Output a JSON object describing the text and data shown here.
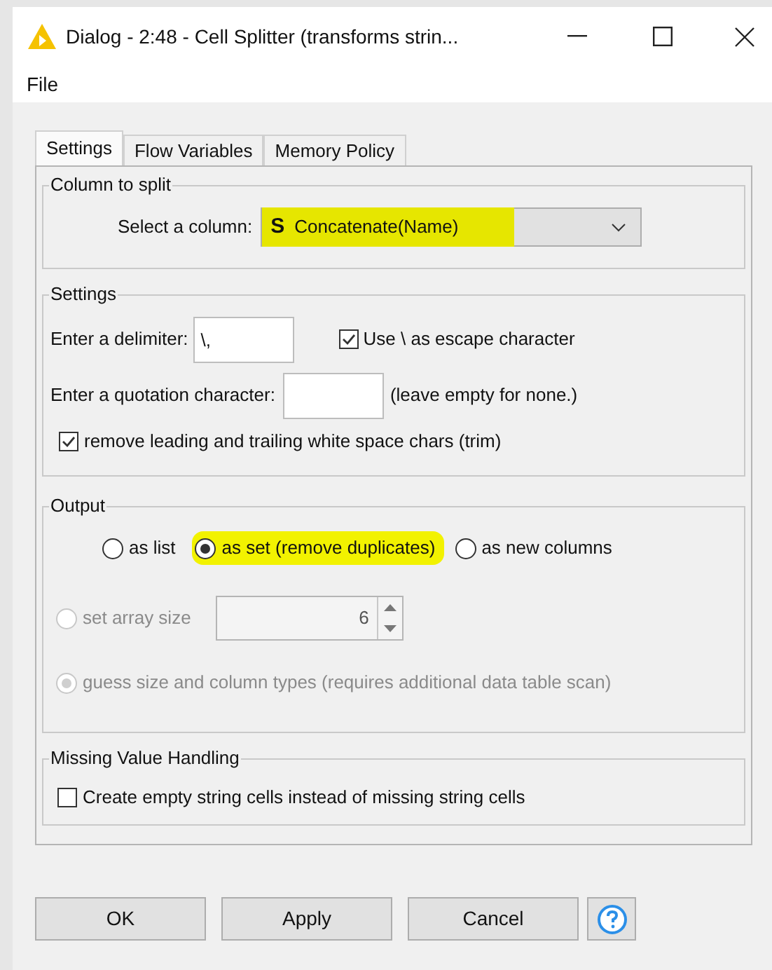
{
  "window": {
    "title": "Dialog - 2:48 - Cell Splitter (transforms strin..."
  },
  "menu": [
    "File"
  ],
  "tabs": [
    {
      "label": "Settings",
      "selected": true
    },
    {
      "label": "Flow Variables",
      "selected": false
    },
    {
      "label": "Memory Policy",
      "selected": false
    }
  ],
  "column_to_split": {
    "title": "Column to split",
    "label": "Select a column:",
    "type_badge": "S",
    "value": "Concatenate(Name)",
    "highlighted": true
  },
  "settings": {
    "title": "Settings",
    "delimiter_label": "Enter a delimiter:",
    "delimiter_value": "\\,",
    "escape": {
      "label": "Use \\ as escape character",
      "checked": true
    },
    "quotation_label": "Enter a quotation character:",
    "quotation_hint": "(leave empty for none.)",
    "trim": {
      "label": "remove leading and trailing white space chars (trim)",
      "checked": true
    }
  },
  "output": {
    "title": "Output",
    "options": [
      {
        "label": "as list",
        "selected": false,
        "highlighted": false
      },
      {
        "label": "as set (remove duplicates)",
        "selected": true,
        "highlighted": true
      },
      {
        "label": "as new columns",
        "selected": false,
        "highlighted": false
      }
    ],
    "size_options": [
      {
        "label": "set array size",
        "selected": false,
        "disabled": true,
        "spinner": "6"
      },
      {
        "label": "guess size and column types (requires additional data table scan)",
        "selected": true,
        "disabled": true
      }
    ]
  },
  "missing": {
    "title": "Missing Value Handling",
    "option": {
      "label": "Create empty string cells instead of missing string cells",
      "checked": false
    }
  },
  "buttons": [
    "OK",
    "Apply",
    "Cancel"
  ]
}
